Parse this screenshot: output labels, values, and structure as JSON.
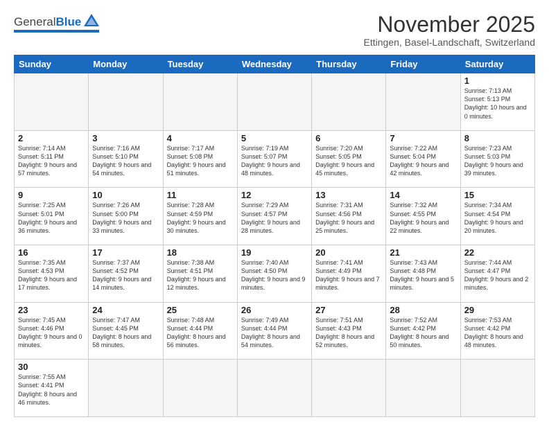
{
  "header": {
    "logo_general": "General",
    "logo_blue": "Blue",
    "month_title": "November 2025",
    "subtitle": "Ettingen, Basel-Landschaft, Switzerland"
  },
  "days_of_week": [
    "Sunday",
    "Monday",
    "Tuesday",
    "Wednesday",
    "Thursday",
    "Friday",
    "Saturday"
  ],
  "weeks": [
    [
      {
        "day": "",
        "info": ""
      },
      {
        "day": "",
        "info": ""
      },
      {
        "day": "",
        "info": ""
      },
      {
        "day": "",
        "info": ""
      },
      {
        "day": "",
        "info": ""
      },
      {
        "day": "",
        "info": ""
      },
      {
        "day": "1",
        "info": "Sunrise: 7:13 AM\nSunset: 5:13 PM\nDaylight: 10 hours\nand 0 minutes."
      }
    ],
    [
      {
        "day": "2",
        "info": "Sunrise: 7:14 AM\nSunset: 5:11 PM\nDaylight: 9 hours\nand 57 minutes."
      },
      {
        "day": "3",
        "info": "Sunrise: 7:16 AM\nSunset: 5:10 PM\nDaylight: 9 hours\nand 54 minutes."
      },
      {
        "day": "4",
        "info": "Sunrise: 7:17 AM\nSunset: 5:08 PM\nDaylight: 9 hours\nand 51 minutes."
      },
      {
        "day": "5",
        "info": "Sunrise: 7:19 AM\nSunset: 5:07 PM\nDaylight: 9 hours\nand 48 minutes."
      },
      {
        "day": "6",
        "info": "Sunrise: 7:20 AM\nSunset: 5:05 PM\nDaylight: 9 hours\nand 45 minutes."
      },
      {
        "day": "7",
        "info": "Sunrise: 7:22 AM\nSunset: 5:04 PM\nDaylight: 9 hours\nand 42 minutes."
      },
      {
        "day": "8",
        "info": "Sunrise: 7:23 AM\nSunset: 5:03 PM\nDaylight: 9 hours\nand 39 minutes."
      }
    ],
    [
      {
        "day": "9",
        "info": "Sunrise: 7:25 AM\nSunset: 5:01 PM\nDaylight: 9 hours\nand 36 minutes."
      },
      {
        "day": "10",
        "info": "Sunrise: 7:26 AM\nSunset: 5:00 PM\nDaylight: 9 hours\nand 33 minutes."
      },
      {
        "day": "11",
        "info": "Sunrise: 7:28 AM\nSunset: 4:59 PM\nDaylight: 9 hours\nand 30 minutes."
      },
      {
        "day": "12",
        "info": "Sunrise: 7:29 AM\nSunset: 4:57 PM\nDaylight: 9 hours\nand 28 minutes."
      },
      {
        "day": "13",
        "info": "Sunrise: 7:31 AM\nSunset: 4:56 PM\nDaylight: 9 hours\nand 25 minutes."
      },
      {
        "day": "14",
        "info": "Sunrise: 7:32 AM\nSunset: 4:55 PM\nDaylight: 9 hours\nand 22 minutes."
      },
      {
        "day": "15",
        "info": "Sunrise: 7:34 AM\nSunset: 4:54 PM\nDaylight: 9 hours\nand 20 minutes."
      }
    ],
    [
      {
        "day": "16",
        "info": "Sunrise: 7:35 AM\nSunset: 4:53 PM\nDaylight: 9 hours\nand 17 minutes."
      },
      {
        "day": "17",
        "info": "Sunrise: 7:37 AM\nSunset: 4:52 PM\nDaylight: 9 hours\nand 14 minutes."
      },
      {
        "day": "18",
        "info": "Sunrise: 7:38 AM\nSunset: 4:51 PM\nDaylight: 9 hours\nand 12 minutes."
      },
      {
        "day": "19",
        "info": "Sunrise: 7:40 AM\nSunset: 4:50 PM\nDaylight: 9 hours\nand 9 minutes."
      },
      {
        "day": "20",
        "info": "Sunrise: 7:41 AM\nSunset: 4:49 PM\nDaylight: 9 hours\nand 7 minutes."
      },
      {
        "day": "21",
        "info": "Sunrise: 7:43 AM\nSunset: 4:48 PM\nDaylight: 9 hours\nand 5 minutes."
      },
      {
        "day": "22",
        "info": "Sunrise: 7:44 AM\nSunset: 4:47 PM\nDaylight: 9 hours\nand 2 minutes."
      }
    ],
    [
      {
        "day": "23",
        "info": "Sunrise: 7:45 AM\nSunset: 4:46 PM\nDaylight: 9 hours\nand 0 minutes."
      },
      {
        "day": "24",
        "info": "Sunrise: 7:47 AM\nSunset: 4:45 PM\nDaylight: 8 hours\nand 58 minutes."
      },
      {
        "day": "25",
        "info": "Sunrise: 7:48 AM\nSunset: 4:44 PM\nDaylight: 8 hours\nand 56 minutes."
      },
      {
        "day": "26",
        "info": "Sunrise: 7:49 AM\nSunset: 4:44 PM\nDaylight: 8 hours\nand 54 minutes."
      },
      {
        "day": "27",
        "info": "Sunrise: 7:51 AM\nSunset: 4:43 PM\nDaylight: 8 hours\nand 52 minutes."
      },
      {
        "day": "28",
        "info": "Sunrise: 7:52 AM\nSunset: 4:42 PM\nDaylight: 8 hours\nand 50 minutes."
      },
      {
        "day": "29",
        "info": "Sunrise: 7:53 AM\nSunset: 4:42 PM\nDaylight: 8 hours\nand 48 minutes."
      }
    ],
    [
      {
        "day": "30",
        "info": "Sunrise: 7:55 AM\nSunset: 4:41 PM\nDaylight: 8 hours\nand 46 minutes."
      },
      {
        "day": "",
        "info": ""
      },
      {
        "day": "",
        "info": ""
      },
      {
        "day": "",
        "info": ""
      },
      {
        "day": "",
        "info": ""
      },
      {
        "day": "",
        "info": ""
      },
      {
        "day": "",
        "info": ""
      }
    ]
  ]
}
